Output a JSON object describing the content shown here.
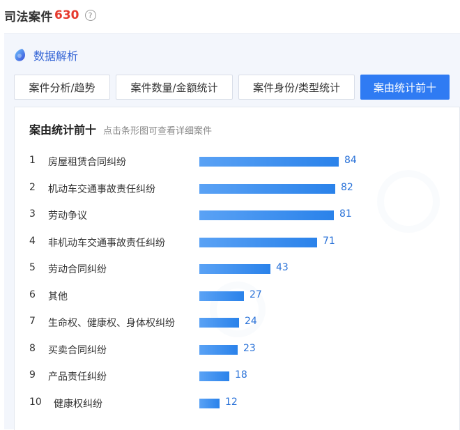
{
  "header": {
    "title": "司法案件",
    "count": "630",
    "help_icon": "?"
  },
  "section": {
    "icon": "data-analysis-icon",
    "title": "数据解析"
  },
  "tabs": [
    {
      "label": "案件分析/趋势",
      "active": false
    },
    {
      "label": "案件数量/金额统计",
      "active": false
    },
    {
      "label": "案件身份/类型统计",
      "active": false
    },
    {
      "label": "案由统计前十",
      "active": true
    }
  ],
  "card": {
    "title": "案由统计前十",
    "subtitle": "点击条形图可查看详细案件"
  },
  "chart_data": {
    "type": "bar",
    "orientation": "horizontal",
    "ranks": [
      "1",
      "2",
      "3",
      "4",
      "5",
      "6",
      "7",
      "8",
      "9",
      "10"
    ],
    "categories": [
      "房屋租赁合同纠纷",
      "机动车交通事故责任纠纷",
      "劳动争议",
      "非机动车交通事故责任纠纷",
      "劳动合同纠纷",
      "其他",
      "生命权、健康权、身体权纠纷",
      "买卖合同纠纷",
      "产品责任纠纷",
      "健康权纠纷"
    ],
    "values": [
      84,
      82,
      81,
      71,
      43,
      27,
      24,
      23,
      18,
      12
    ],
    "bar_color": "#2a82ea",
    "value_color": "#2a72d8"
  }
}
